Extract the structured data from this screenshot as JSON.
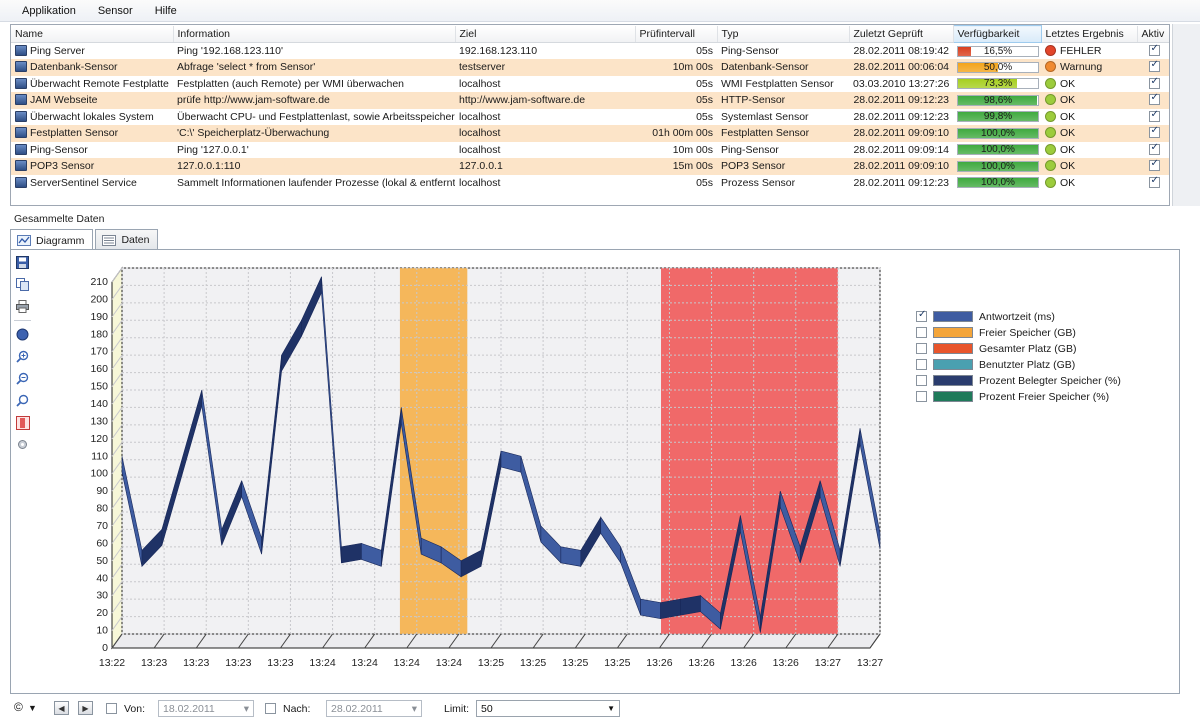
{
  "menu": [
    "Applikation",
    "Sensor",
    "Hilfe"
  ],
  "columns": {
    "name": "Name",
    "information": "Information",
    "ziel": "Ziel",
    "interval": "Prüfintervall",
    "typ": "Typ",
    "zuletzt": "Zuletzt Geprüft",
    "verfuegbarkeit": "Verfügbarkeit",
    "ergebnis": "Letztes Ergebnis",
    "aktiv": "Aktiv"
  },
  "rows": [
    {
      "name": "Ping Server",
      "info": "Ping '192.168.123.110'",
      "ziel": "192.168.123.110",
      "interval": "05s",
      "typ": "Ping-Sensor",
      "zuletzt": "28.02.2011 08:19:42",
      "avail_label": "16,5%",
      "avail": 0.165,
      "avail_color": "#d9401f",
      "ergebnis": "FEHLER",
      "status_color": "#e2452a",
      "aktiv": true
    },
    {
      "name": "Datenbank-Sensor",
      "info": "Abfrage 'select * from Sensor'",
      "ziel": "testserver",
      "interval": "10m 00s",
      "typ": "Datenbank-Sensor",
      "zuletzt": "28.02.2011 00:06:04",
      "avail_label": "50,0%",
      "avail": 0.5,
      "avail_color": "#f3a41a",
      "ergebnis": "Warnung",
      "status_color": "#f08a30",
      "aktiv": true
    },
    {
      "name": "Überwacht Remote Festplatte",
      "info": "Festplatten (auch Remote) per WMI überwachen",
      "ziel": "localhost",
      "interval": "05s",
      "typ": "WMI Festplatten Sensor",
      "zuletzt": "03.03.2010 13:27:26",
      "avail_label": "73,3%",
      "avail": 0.733,
      "avail_color": "#a6cf1f",
      "ergebnis": "OK",
      "status_color": "#9ccc3c",
      "aktiv": true
    },
    {
      "name": "JAM Webseite",
      "info": "prüfe http://www.jam-software.de",
      "ziel": "http://www.jam-software.de",
      "interval": "05s",
      "typ": "HTTP-Sensor",
      "zuletzt": "28.02.2011 09:12:23",
      "avail_label": "98,6%",
      "avail": 0.986,
      "avail_color": "#3faa3f",
      "ergebnis": "OK",
      "status_color": "#9ccc3c",
      "aktiv": true
    },
    {
      "name": "Überwacht lokales System",
      "info": "Überwacht CPU- und Festplattenlast, sowie Arbeitsspeicher",
      "ziel": "localhost",
      "interval": "05s",
      "typ": "Systemlast Sensor",
      "zuletzt": "28.02.2011 09:12:23",
      "avail_label": "99,8%",
      "avail": 0.998,
      "avail_color": "#3faa3f",
      "ergebnis": "OK",
      "status_color": "#9ccc3c",
      "aktiv": true
    },
    {
      "name": "Festplatten Sensor",
      "info": "'C:\\' Speicherplatz-Überwachung",
      "ziel": "localhost",
      "interval": "01h 00m 00s",
      "typ": "Festplatten Sensor",
      "zuletzt": "28.02.2011 09:09:10",
      "avail_label": "100,0%",
      "avail": 1.0,
      "avail_color": "#3faa3f",
      "ergebnis": "OK",
      "status_color": "#9ccc3c",
      "aktiv": true
    },
    {
      "name": "Ping-Sensor",
      "info": "Ping '127.0.0.1'",
      "ziel": "localhost",
      "interval": "10m 00s",
      "typ": "Ping-Sensor",
      "zuletzt": "28.02.2011 09:09:14",
      "avail_label": "100,0%",
      "avail": 1.0,
      "avail_color": "#3faa3f",
      "ergebnis": "OK",
      "status_color": "#9ccc3c",
      "aktiv": true
    },
    {
      "name": "POP3 Sensor",
      "info": "127.0.0.1:110",
      "ziel": "127.0.0.1",
      "interval": "15m 00s",
      "typ": "POP3 Sensor",
      "zuletzt": "28.02.2011 09:09:10",
      "avail_label": "100,0%",
      "avail": 1.0,
      "avail_color": "#3faa3f",
      "ergebnis": "OK",
      "status_color": "#9ccc3c",
      "aktiv": true
    },
    {
      "name": "ServerSentinel Service",
      "info": "Sammelt Informationen laufender Prozesse (lokal & entfernt)",
      "ziel": "localhost",
      "interval": "05s",
      "typ": "Prozess Sensor",
      "zuletzt": "28.02.2011 09:12:23",
      "avail_label": "100,0%",
      "avail": 1.0,
      "avail_color": "#3faa3f",
      "ergebnis": "OK",
      "status_color": "#9ccc3c",
      "aktiv": true
    }
  ],
  "section_title": "Gesammelte Daten",
  "tabs": {
    "diagramm": "Diagramm",
    "daten": "Daten"
  },
  "legend": [
    {
      "label": "Antwortzeit (ms)",
      "color": "#3e5ca1",
      "checked": true
    },
    {
      "label": "Freier Speicher (GB)",
      "color": "#f4a53a",
      "checked": false
    },
    {
      "label": "Gesamter Platz (GB)",
      "color": "#e8552c",
      "checked": false
    },
    {
      "label": "Benutzter Platz (GB)",
      "color": "#4aa0b0",
      "checked": false
    },
    {
      "label": "Prozent Belegter Speicher (%)",
      "color": "#2a3c6e",
      "checked": false
    },
    {
      "label": "Prozent Freier Speicher (%)",
      "color": "#1f7a5a",
      "checked": false
    }
  ],
  "bottom": {
    "von_label": "Von:",
    "von_value": "18.02.2011",
    "nach_label": "Nach:",
    "nach_value": "28.02.2011",
    "limit_label": "Limit:",
    "limit_value": "50",
    "copyright": "©"
  },
  "chart_data": {
    "type": "line",
    "title": "",
    "xlabel": "",
    "ylabel": "",
    "ylim": [
      0,
      210
    ],
    "yticks": [
      0,
      10,
      20,
      30,
      40,
      50,
      60,
      70,
      80,
      90,
      100,
      110,
      120,
      130,
      140,
      150,
      160,
      170,
      180,
      190,
      200,
      210
    ],
    "x_tick_labels": [
      "13:22",
      "13:23",
      "13:23",
      "13:23",
      "13:23",
      "13:24",
      "13:24",
      "13:24",
      "13:24",
      "13:25",
      "13:25",
      "13:25",
      "13:25",
      "13:26",
      "13:26",
      "13:26",
      "13:26",
      "13:27",
      "13:27"
    ],
    "series": [
      {
        "name": "Antwortzeit (ms)",
        "values": [
          102,
          48,
          60,
          100,
          140,
          60,
          88,
          55,
          160,
          180,
          205,
          50,
          52,
          48,
          130,
          55,
          50,
          42,
          48,
          105,
          102,
          62,
          50,
          48,
          67,
          50,
          20,
          18,
          20,
          22,
          12,
          68,
          10,
          82,
          50,
          88,
          48,
          118,
          58
        ],
        "color": "#3e5ca1"
      }
    ],
    "highlight_bands": [
      {
        "from_index": 6.6,
        "to_index": 8.2,
        "color": "#f5b04a"
      },
      {
        "from_index": 12.8,
        "to_index": 17.0,
        "color": "#ef5a5a"
      }
    ],
    "grid": true,
    "legend_position": "right"
  }
}
